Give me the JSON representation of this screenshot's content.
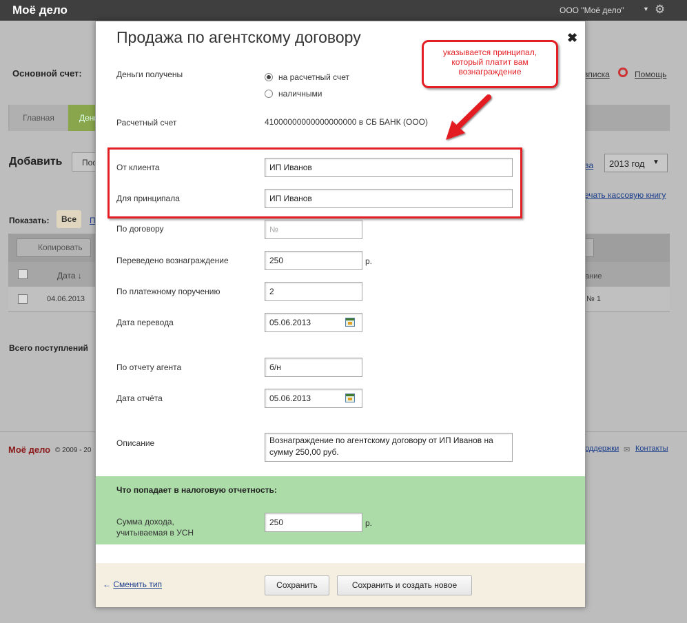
{
  "topbar": {
    "logo": "Моё дело",
    "org": "ООО \"Моё дело\"",
    "org_arrow": "▼",
    "settings_icon": "gear-icon"
  },
  "background": {
    "account_label": "Основной счет:",
    "link_partial": "вписка",
    "help_link": "Помощь",
    "tab_main": "Главная",
    "tab_money": "Деньги",
    "add_label": "Добавить",
    "add_button": "Поступление",
    "period_link": "за",
    "year_select": "2013 год",
    "kassa_link": "ечать кассовую книгу",
    "show_label": "Показать:",
    "show_all": "Все",
    "show_more": "Поступления",
    "copy_button": "Копировать",
    "col_date": "Дата ↓",
    "col_desc": "ание",
    "row_date": "04.06.2013",
    "row_no": "№ 1",
    "total_label": "Всего поступлений",
    "footer_logo": "Моё дело",
    "footer_copy": "© 2009 - 20",
    "footer_support": "оддержки",
    "footer_contacts": "Контакты"
  },
  "modal": {
    "title": "Продажа по агентскому договору",
    "close_icon": "close-icon",
    "money_received_label": "Деньги получены",
    "radio_account": "на расчетный счет",
    "radio_cash": "наличными",
    "account_label": "Расчетный счет",
    "account_value": "41000000000000000000 в СБ БАНК (ООО)",
    "from_client_label": "От клиента",
    "from_client_value": "ИП Иванов",
    "for_principal_label": "Для принципала",
    "for_principal_value": "ИП Иванов",
    "contract_label": "По договору",
    "contract_placeholder": "№",
    "commission_label": "Переведено вознаграждение",
    "commission_value": "250",
    "currency": "р.",
    "payment_order_label": "По платежному поручению",
    "payment_order_value": "2",
    "transfer_date_label": "Дата перевода",
    "transfer_date_value": "05.06.2013",
    "agent_report_label": "По отчету агента",
    "agent_report_value": "б/н",
    "report_date_label": "Дата отчёта",
    "report_date_value": "05.06.2013",
    "description_label": "Описание",
    "description_value": "Вознаграждение по агентскому договору от ИП Иванов на сумму 250,00 руб.",
    "tax_title": "Что попадает в налоговую отчетность:",
    "income_label_1": "Сумма дохода,",
    "income_label_2": "учитываемая в УСН",
    "income_value": "250",
    "change_type_arrow": "←",
    "change_type_link": "Сменить тип",
    "save_button": "Сохранить",
    "save_new_button": "Сохранить и создать новое"
  },
  "annotation": {
    "callout_line1": "указывается принципал,",
    "callout_line2": "который платит вам",
    "callout_line3": "вознаграждение",
    "color": "#e31e24"
  }
}
